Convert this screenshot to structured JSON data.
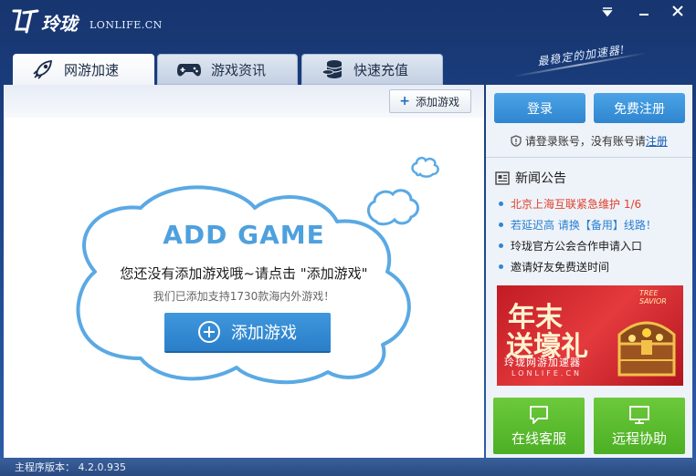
{
  "header": {
    "logo_cn": "玲珑",
    "logo_en": "LONLIFE.CN",
    "slogan": "最稳定的加速器!",
    "window_controls": [
      "menu-icon",
      "minimize-icon",
      "close-icon"
    ]
  },
  "tabs": [
    {
      "label": "网游加速",
      "icon": "rocket-icon",
      "active": true
    },
    {
      "label": "游戏资讯",
      "icon": "gamepad-icon",
      "active": false
    },
    {
      "label": "快速充值",
      "icon": "coins-icon",
      "active": false
    }
  ],
  "main": {
    "add_game_small": "添加游戏",
    "title": "ADD GAME",
    "message": "您还没有添加游戏哦~请点击 \"添加游戏\"",
    "sub_message": "我们已添加支持1730款海内外游戏！",
    "add_game_big": "添加游戏"
  },
  "sidebar": {
    "login_label": "登录",
    "register_label": "免费注册",
    "login_hint": "请登录账号，没有账号请",
    "register_link": "注册",
    "news_title": "新闻公告",
    "news": [
      {
        "text": "北京上海互联紧急维护 1/6",
        "color": "#e0412f"
      },
      {
        "text": "若延迟高 请换【备用】线路！",
        "color": "#2a7fd0"
      },
      {
        "text": "玲珑官方公会合作申请入口",
        "color": "#1c1c1c"
      },
      {
        "text": "邀请好友免费送时间",
        "color": "#1c1c1c"
      }
    ],
    "banner": {
      "line1": "年末",
      "line2": "送壕礼",
      "line3": "玲珑网游加速器",
      "line4": "LONLIFE.CN",
      "brand": "TREE SAVIOR"
    },
    "support_label": "在线客服",
    "remote_label": "远程协助"
  },
  "status": {
    "version_text": "主程序版本： 4.2.0.935"
  },
  "colors": {
    "accent_blue": "#2f86cf",
    "accent_green": "#4caf24",
    "header_bg": "#17356f"
  }
}
